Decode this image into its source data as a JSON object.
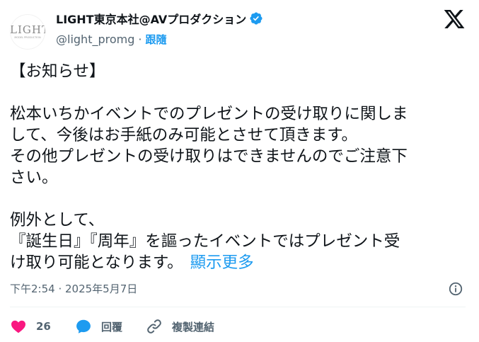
{
  "author": {
    "display_name": "LIGHT東京本社@AVプロダクション",
    "handle": "@light_promg",
    "separator": "·",
    "follow_label": "跟隨",
    "avatar_logo_text": "LIGHT",
    "avatar_sub_text": "MODEL PRODUCTION"
  },
  "tweet": {
    "lines": [
      "【お知らせ】",
      "松本いちかイベントでのプレゼントの受け取りに関しま",
      "して、今後はお手紙のみ可能とさせて頂きます。",
      "その他プレゼントの受け取りはできませんのでご注意下",
      "さい。",
      "例外として、",
      "『誕生日』『周年』を謳ったイベントではプレゼント受",
      "け取り可能となります。"
    ],
    "show_more": "顯示更多",
    "timestamp": "下午2:54 · 2025年5月7日"
  },
  "actions": {
    "like_count": "26",
    "reply_label": "回覆",
    "copy_link_label": "複製連結"
  },
  "colors": {
    "accent": "#1d9bf0",
    "like": "#f91880",
    "secondary_text": "#536471"
  },
  "icons": [
    "x-logo-icon",
    "verified-badge-icon",
    "info-icon",
    "heart-icon",
    "reply-bubble-icon",
    "link-icon"
  ]
}
